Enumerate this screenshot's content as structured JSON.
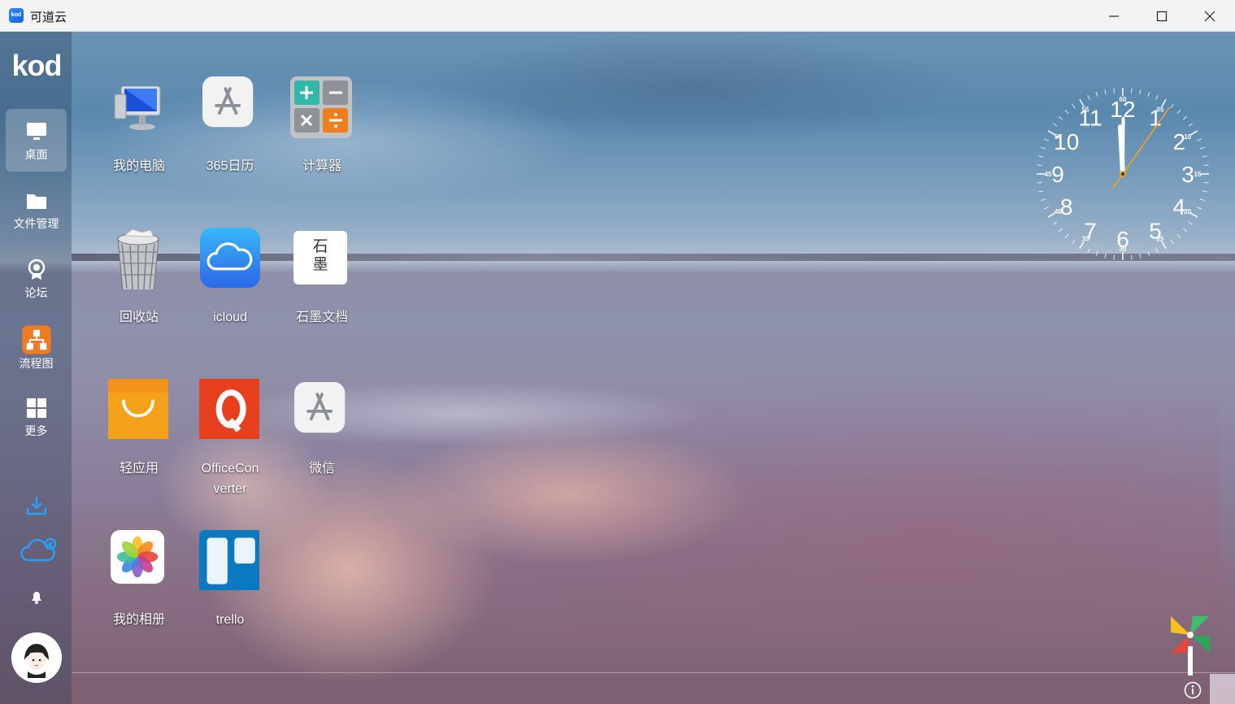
{
  "window": {
    "app_icon_text": "kod",
    "title": "可道云",
    "buttons": [
      "minimize-icon",
      "maximize-icon",
      "close-icon"
    ]
  },
  "sidebar": {
    "logo": "kod",
    "items": [
      {
        "label": "桌面",
        "icon": "desktop-icon",
        "active": true
      },
      {
        "label": "文件管理",
        "icon": "folder-icon",
        "active": false
      },
      {
        "label": "论坛",
        "icon": "badge-icon",
        "active": false
      },
      {
        "label": "流程图",
        "icon": "flowchart-icon",
        "active": false
      },
      {
        "label": "更多",
        "icon": "grid-icon",
        "active": false
      }
    ],
    "utilities": [
      "download-icon",
      "cloud-settings-icon",
      "bell-icon"
    ],
    "avatar": "user-avatar"
  },
  "desktop": {
    "icons": [
      {
        "label": "我的电脑",
        "icon": "computer-icon"
      },
      {
        "label": "365日历",
        "icon": "appstore-icon"
      },
      {
        "label": "计算器",
        "icon": "calculator-icon"
      },
      {
        "label": "回收站",
        "icon": "recycle-bin-icon"
      },
      {
        "label": "icloud",
        "icon": "icloud-icon"
      },
      {
        "label": "石墨文档",
        "icon": "shimo-icon",
        "icon_text": "石\n墨"
      },
      {
        "label": "轻应用",
        "icon": "shopping-bag-icon"
      },
      {
        "label": "OfficeConverter",
        "icon": "office-converter-icon"
      },
      {
        "label": "微信",
        "icon": "appstore-icon"
      },
      {
        "label": "我的相册",
        "icon": "photos-icon"
      },
      {
        "label": "trello",
        "icon": "trello-icon"
      }
    ],
    "label_lines": {
      "office_1": "OfficeCon",
      "office_2": "verter",
      "shimo_1": "石",
      "shimo_2": "墨"
    }
  },
  "clock": {
    "hours": [
      "12",
      "1",
      "2",
      "3",
      "4",
      "5",
      "6",
      "7",
      "8",
      "9",
      "10",
      "11"
    ],
    "minutes": [
      "60",
      "05",
      "10",
      "15",
      "20",
      "25",
      "30",
      "35",
      "40",
      "45",
      "50",
      "55"
    ],
    "time": {
      "hour": 12,
      "minute": 0,
      "second": 5
    }
  },
  "bottom": {
    "pinwheel": "pinwheel-icon",
    "info": "info-icon"
  }
}
